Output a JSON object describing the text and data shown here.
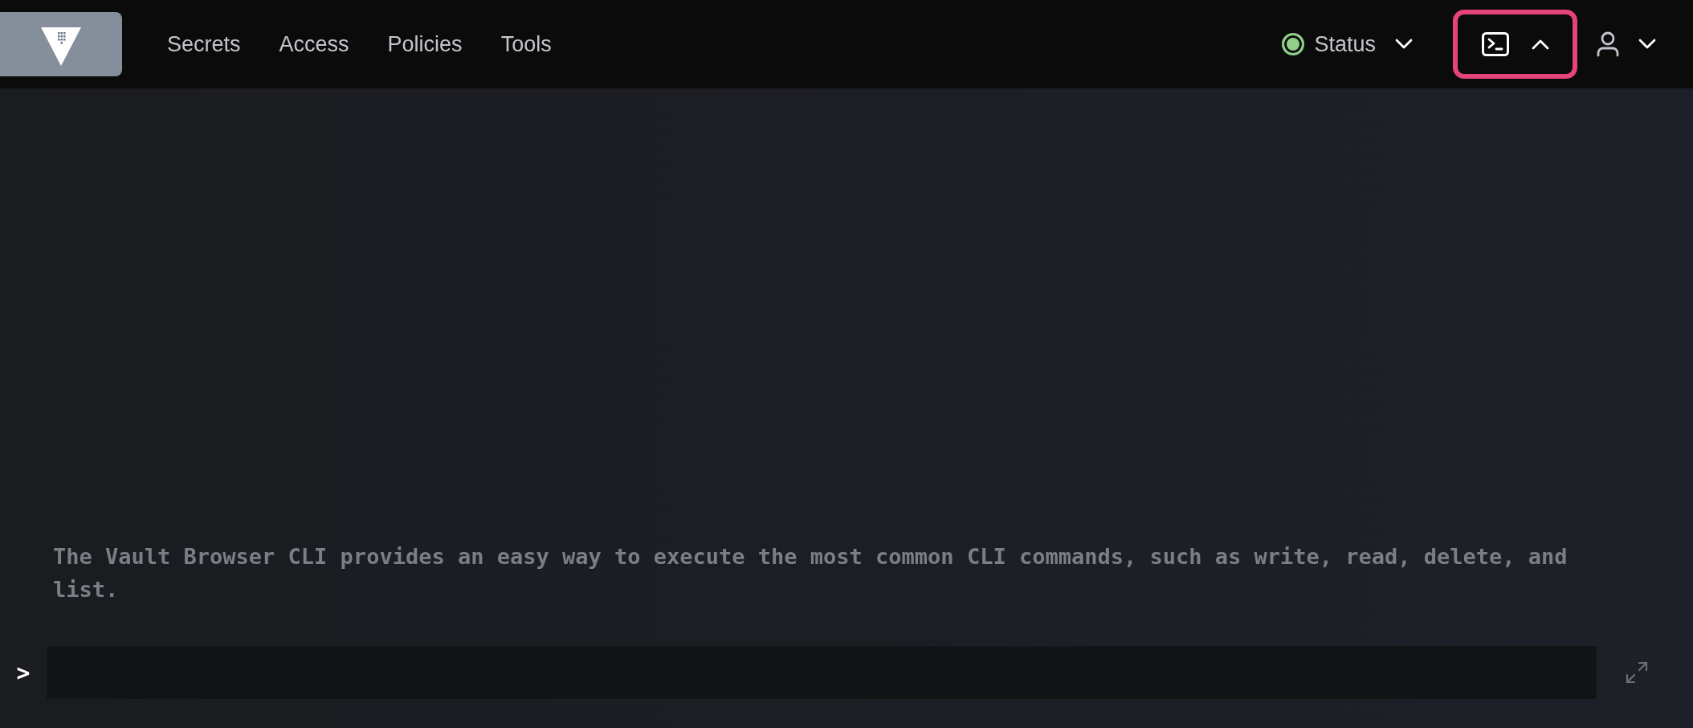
{
  "nav": [
    {
      "label": "Secrets"
    },
    {
      "label": "Access"
    },
    {
      "label": "Policies"
    },
    {
      "label": "Tools"
    }
  ],
  "status": {
    "label": "Status",
    "color": "#8fcf86"
  },
  "console_toggle": {
    "highlighted": true,
    "expanded": true
  },
  "cli": {
    "description": "The Vault Browser CLI provides an easy way to execute the most common CLI commands, such as write, read, delete, and list.",
    "prompt": ">"
  }
}
